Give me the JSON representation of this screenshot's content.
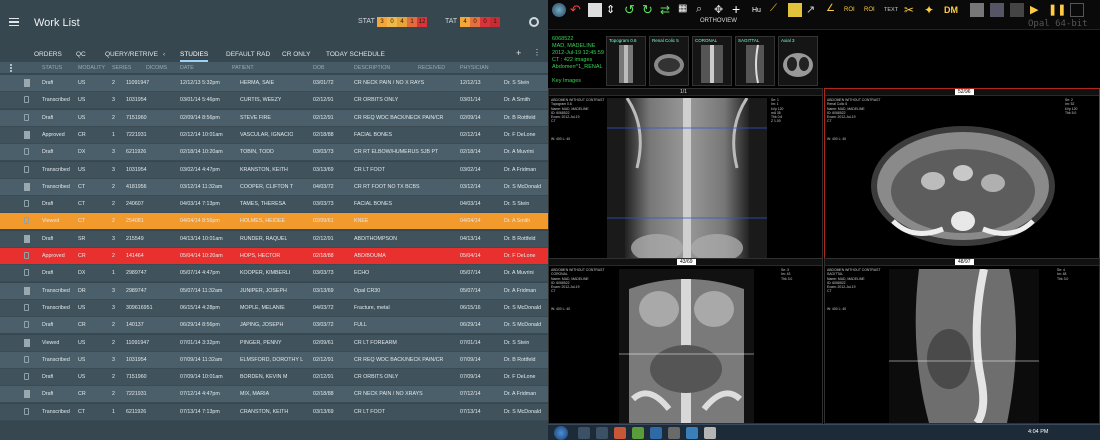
{
  "worklist": {
    "title": "Work List",
    "stat_label": "STAT",
    "stat_values": [
      "3",
      "0",
      "4",
      "1",
      "12"
    ],
    "tat_label": "TAT",
    "tat_values": [
      "4",
      "0",
      "0",
      "1"
    ],
    "stat_colors": [
      "#f4a63b",
      "#f0b84a",
      "#e8a23a",
      "#e36b3e",
      "#d9333b"
    ],
    "tat_colors": [
      "#f4a63b",
      "#e3703e",
      "#d9333b",
      "#c72c35"
    ],
    "tabs": [
      "ORDERS",
      "QC",
      "QUERY/RETRIVE",
      "STUDIES",
      "DEFAULT RAD",
      "CR ONLY",
      "TODAY SCHEDULE"
    ],
    "active_tab": "STUDIES",
    "columns": [
      "STATUS",
      "MODALITY",
      "SERIES",
      "DICOMS",
      "DATE",
      "PATIENT",
      "DOB",
      "DESCRIPTION",
      "RECEIVED",
      "PHYSICIAN"
    ],
    "rows": [
      {
        "status": "Draft",
        "mod": "US",
        "series": "2",
        "dicoms": "11091947",
        "date": "12/12/13  5:32pm",
        "patient": "HERMA, SAIE",
        "dob": "03/01/72",
        "desc": "CR NECK PAIN / NO X RAYS",
        "received": "12/12/13",
        "phys": "Dr. S Stein",
        "hl": ""
      },
      {
        "status": "Transcribed",
        "mod": "US",
        "series": "3",
        "dicoms": "1031954",
        "date": "03/01/14  5:46pm",
        "patient": "CURTIS, WEEZY",
        "dob": "02/12/91",
        "desc": "CR ORBITS ONLY",
        "received": "03/01/14",
        "phys": "Dr. A Smith",
        "hl": ""
      },
      {
        "status": "Draft",
        "mod": "US",
        "series": "2",
        "dicoms": "7151960",
        "date": "02/09/14  8:56pm",
        "patient": "STEVE FIRE",
        "dob": "02/12/91",
        "desc": "CR REQ WDC BACK/NECK PAIN/CR",
        "received": "02/09/14",
        "phys": "Dr. B Rottfeld",
        "hl": ""
      },
      {
        "status": "Approved",
        "mod": "CR",
        "series": "1",
        "dicoms": "7221931",
        "date": "02/12/14  10:01am",
        "patient": "VASCULAR, IGNACIO",
        "dob": "02/18/88",
        "desc": "FACIAL BONES",
        "received": "02/12/14",
        "phys": "Dr. F DeLone",
        "hl": ""
      },
      {
        "status": "Draft",
        "mod": "DX",
        "series": "3",
        "dicoms": "6211926",
        "date": "02/18/14  10:20am",
        "patient": "TOBIN, TODD",
        "dob": "03/03/73",
        "desc": "CR RT ELBOW/HUMERUS SJB PT",
        "received": "02/18/14",
        "phys": "Dr. A Muvrini",
        "hl": ""
      },
      {
        "status": "Transcribed",
        "mod": "US",
        "series": "3",
        "dicoms": "1031954",
        "date": "03/02/14  4:47pm",
        "patient": "KRANSTON, KEITH",
        "dob": "03/13/69",
        "desc": "CR LT FOOT",
        "received": "03/02/14",
        "phys": "Dr. A Fridman",
        "hl": ""
      },
      {
        "status": "Transcribed",
        "mod": "CT",
        "series": "2",
        "dicoms": "4181956",
        "date": "03/12/14  11:32am",
        "patient": "COOPER, CLIFTON T",
        "dob": "04/03/72",
        "desc": "CR RT FOOT NO TX BCBS",
        "received": "03/12/14",
        "phys": "Dr. S McDonald",
        "hl": ""
      },
      {
        "status": "Draft",
        "mod": "CT",
        "series": "2",
        "dicoms": "240607",
        "date": "04/03/14  7:13pm",
        "patient": "TAMES, THERESA",
        "dob": "03/03/73",
        "desc": "FACIAL BONES",
        "received": "04/03/14",
        "phys": "Dr. S Stein",
        "hl": ""
      },
      {
        "status": "Viewed",
        "mod": "CT",
        "series": "2",
        "dicoms": "254081",
        "date": "04/04/14  8:56pm",
        "patient": "HOLMES, HEIDEE",
        "dob": "02/09/61",
        "desc": "KNEE",
        "received": "04/04/14",
        "phys": "Dr. A Smith",
        "hl": "orange"
      },
      {
        "status": "Draft",
        "mod": "SR",
        "series": "3",
        "dicoms": "215549",
        "date": "04/13/14  10:01am",
        "patient": "RUNDER, RAQUEL",
        "dob": "02/12/91",
        "desc": "ABD/THOMPSON",
        "received": "04/13/14",
        "phys": "Dr. B Rottfeld",
        "hl": ""
      },
      {
        "status": "Approved",
        "mod": "CR",
        "series": "2",
        "dicoms": "141464",
        "date": "05/04/14  10:20am",
        "patient": "HOPS, HECTOR",
        "dob": "02/18/88",
        "desc": "ABD/BOUMA",
        "received": "05/04/14",
        "phys": "Dr. F DeLone",
        "hl": "red"
      },
      {
        "status": "Draft",
        "mod": "DX",
        "series": "1",
        "dicoms": "2989747",
        "date": "05/07/14  4:47pm",
        "patient": "KOOPER, KIMBERLI",
        "dob": "03/03/73",
        "desc": "ECHO",
        "received": "05/07/14",
        "phys": "Dr. A Muvrini",
        "hl": ""
      },
      {
        "status": "Transcribed",
        "mod": "DR",
        "series": "3",
        "dicoms": "2989747",
        "date": "05/07/14  11:32am",
        "patient": "JUNIPER, JOSEPH",
        "dob": "03/13/69",
        "desc": "Opal CR30",
        "received": "05/07/14",
        "phys": "Dr. A Fridman",
        "hl": ""
      },
      {
        "status": "Transcribed",
        "mod": "US",
        "series": "3",
        "dicoms": "309616951",
        "date": "06/15/14  4:28pm",
        "patient": "MOPLE, MELANIE",
        "dob": "04/03/72",
        "desc": "Fracture, metal",
        "received": "06/15/16",
        "phys": "Dr. S McDonald",
        "hl": ""
      },
      {
        "status": "Draft",
        "mod": "CR",
        "series": "2",
        "dicoms": "140137",
        "date": "06/29/14  8:56pm",
        "patient": "JAPING, JOSEPH",
        "dob": "03/03/72",
        "desc": "FULL",
        "received": "06/29/14",
        "phys": "Dr. S McDonald",
        "hl": ""
      },
      {
        "status": "Viewed",
        "mod": "US",
        "series": "2",
        "dicoms": "11091947",
        "date": "07/01/14  3:32pm",
        "patient": "PINGER, PENNY",
        "dob": "02/09/61",
        "desc": "CR LT FOREARM",
        "received": "07/01/14",
        "phys": "Dr. S Stein",
        "hl": ""
      },
      {
        "status": "Transcribed",
        "mod": "US",
        "series": "3",
        "dicoms": "1031954",
        "date": "07/09/14  11:32am",
        "patient": "ELMSFORD, DOROTHY L",
        "dob": "02/12/91",
        "desc": "CR REQ WDC BACK/NECK PAIN/CR",
        "received": "07/09/14",
        "phys": "Dr. B Rottfeld",
        "hl": ""
      },
      {
        "status": "Draft",
        "mod": "US",
        "series": "2",
        "dicoms": "7151960",
        "date": "07/09/14  10:01am",
        "patient": "BORDEN, KEVIN M",
        "dob": "02/12/91",
        "desc": "CR ORBITS ONLY",
        "received": "07/09/14",
        "phys": "Dr. F DeLone",
        "hl": ""
      },
      {
        "status": "Draft",
        "mod": "CR",
        "series": "2",
        "dicoms": "7221931",
        "date": "07/12/14  4:47pm",
        "patient": "MIX, MARIA",
        "dob": "02/18/88",
        "desc": "CR NECK PAIN / NO XRAYS",
        "received": "07/12/14",
        "phys": "Dr. A Fridman",
        "hl": ""
      },
      {
        "status": "Transcribed",
        "mod": "CT",
        "series": "1",
        "dicoms": "6211926",
        "date": "07/13/14  7:13pm",
        "patient": "CRANSTON, KEITH",
        "dob": "03/13/69",
        "desc": "CR LT FOOT",
        "received": "07/13/14",
        "phys": "Dr. S McDonald",
        "hl": ""
      }
    ]
  },
  "pacs": {
    "ortho_label": "ORTHOVIEW",
    "opal_label": "Opal 64-bit",
    "patient_id": "6068522",
    "patient_name": "MAD, MADELINE",
    "study_date": "2012-Jul-19  12:45:59",
    "study_desc": "CT : 422 images",
    "study_sub": "Abdomen^1_RENAL",
    "key_images": "Key Images",
    "thumbs": [
      "Topogram 0.6",
      "Renal Colic 5",
      "CORONAL",
      "SAGITTAL",
      "Axial 3"
    ],
    "viewports": [
      {
        "counter": "1/1",
        "label": "topogram"
      },
      {
        "counter": "52/96",
        "label": "axial"
      },
      {
        "counter": "43/69",
        "label": "coronal"
      },
      {
        "counter": "48/97",
        "label": "sagittal"
      }
    ],
    "clock": "4:04 PM",
    "toolbar_labels": [
      "Hu",
      "ROI",
      "ROI",
      "TEXT",
      "DM"
    ]
  }
}
